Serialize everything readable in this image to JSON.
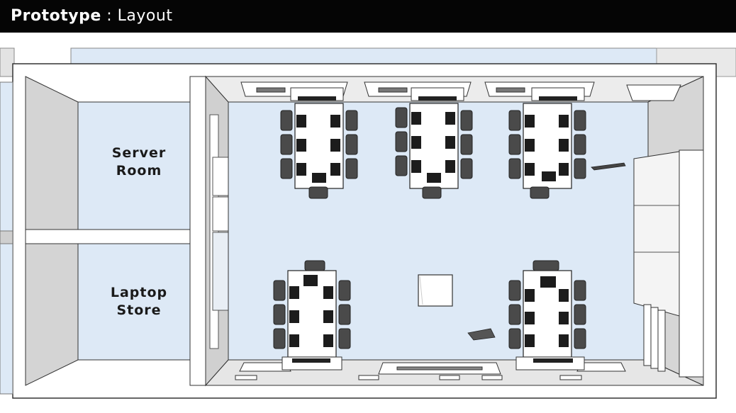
{
  "header": {
    "title_strong": "Prototype",
    "title_separator": " : ",
    "title_light": "Layout"
  },
  "rooms": {
    "server_room": {
      "line1": "Server",
      "line2": "Room"
    },
    "laptop_store": {
      "line1": "Laptop",
      "line2": "Store"
    }
  },
  "colors": {
    "floor": "#dde9f6",
    "wall": "#ffffff",
    "chair": "#4a4a4a",
    "laptop": "#1c1c1c",
    "header_bg": "#050505"
  }
}
